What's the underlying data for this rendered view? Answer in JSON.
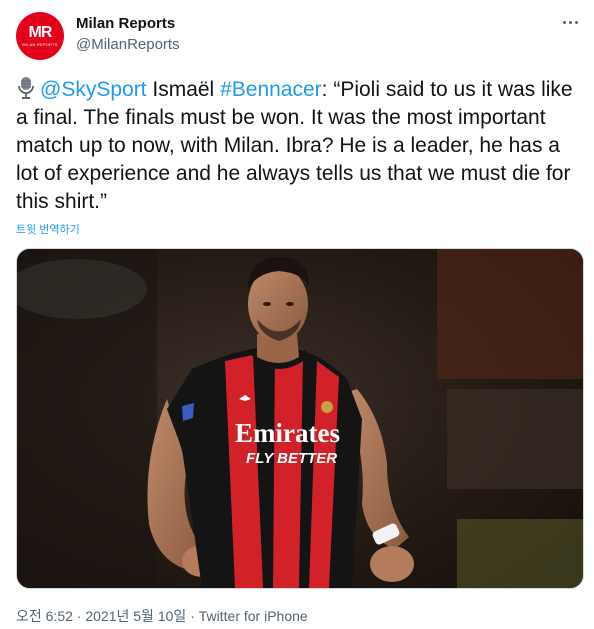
{
  "author": {
    "avatar_logo": "MR",
    "avatar_subtext": "MILAN REPORTS",
    "display_name": "Milan Reports",
    "handle": "@MilanReports"
  },
  "tweet": {
    "mic_icon": "microphone-icon",
    "mention": "@SkySport",
    "text_before_hashtag": "Ismaël",
    "hashtag": "#Bennacer",
    "quote": ": “Pioli said to us it was like a final. The finals must be won. It was the most important match up to now, with Milan. Ibra? He is a leader, he has a lot of experience and he always tells us that we must die for this shirt.”",
    "translate_label": "트윗 번역하기"
  },
  "media": {
    "shirt_sponsor": "Emirates",
    "shirt_slogan": "FLY BETTER"
  },
  "meta": {
    "time": "오전 6:52",
    "separator": "·",
    "date": "2021년 5월 10일",
    "source": "Twitter for iPhone"
  },
  "colors": {
    "accent": "#1d9bf0",
    "brand_red": "#e3001b",
    "secondary_text": "#536471"
  }
}
